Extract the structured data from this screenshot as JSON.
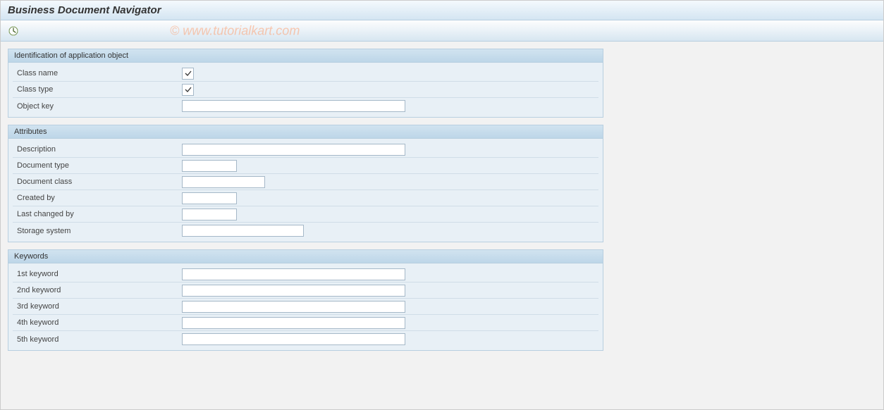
{
  "header": {
    "title": "Business Document Navigator"
  },
  "watermark": "© www.tutorialkart.com",
  "groups": {
    "identification": {
      "title": "Identification of application object",
      "class_name_label": "Class name",
      "class_type_label": "Class type",
      "object_key_label": "Object key",
      "class_name_checked": "",
      "class_type_checked": "",
      "object_key_value": ""
    },
    "attributes": {
      "title": "Attributes",
      "description_label": "Description",
      "document_type_label": "Document type",
      "document_class_label": "Document class",
      "created_by_label": "Created by",
      "last_changed_by_label": "Last changed by",
      "storage_system_label": "Storage system",
      "description_value": "",
      "document_type_value": "",
      "document_class_value": "",
      "created_by_value": "",
      "last_changed_by_value": "",
      "storage_system_value": ""
    },
    "keywords": {
      "title": "Keywords",
      "k1_label": "1st keyword",
      "k2_label": "2nd keyword",
      "k3_label": "3rd keyword",
      "k4_label": "4th keyword",
      "k5_label": "5th keyword",
      "k1_value": "",
      "k2_value": "",
      "k3_value": "",
      "k4_value": "",
      "k5_value": ""
    }
  }
}
